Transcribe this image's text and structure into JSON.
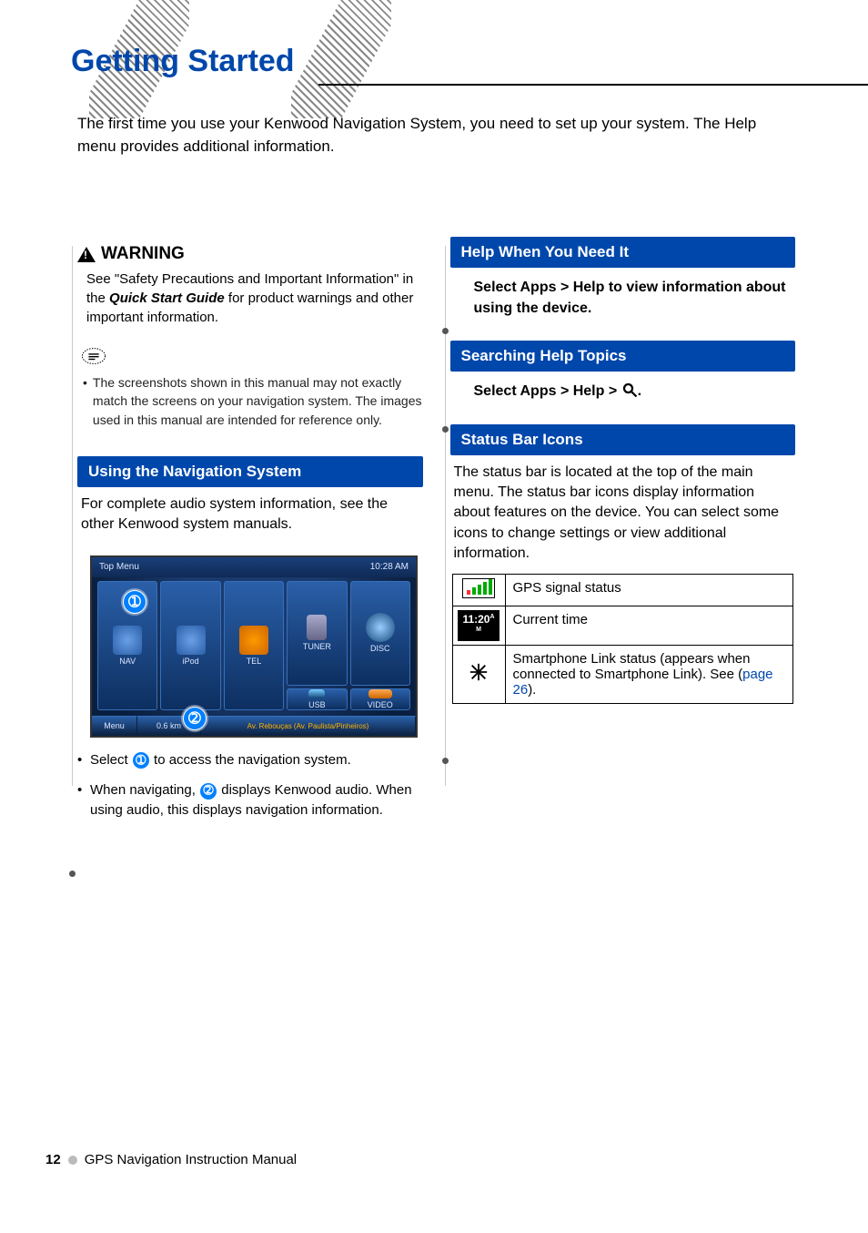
{
  "title": "Getting Started",
  "intro": "The first time you use your Kenwood Navigation System, you need to set up your system. The Help menu provides additional information.",
  "warning": {
    "label": "WARNING",
    "body_pre": "See \"Safety Precautions and Important Information\" in the ",
    "body_italic": "Quick Start Guide",
    "body_post": " for product warnings and other important information."
  },
  "note_bullet": "The screenshots shown in this manual may not exactly match the screens on your navigation system. The images used in this manual are intended for reference only.",
  "using_nav": {
    "bar": "Using the Navigation System",
    "text": "For complete audio system information, see the other Kenwood system manuals.",
    "bullets": {
      "b1_pre": "Select ",
      "b1_post": " to access the navigation system.",
      "b2_pre": "When navigating, ",
      "b2_post": " displays Kenwood audio. When using audio, this displays navigation information."
    }
  },
  "screenshot": {
    "top_label": "Top Menu",
    "clock": "10:28 AM",
    "tiles": [
      "NAV",
      "iPod",
      "TEL",
      "TUNER",
      "DISC",
      "USB",
      "VIDEO"
    ],
    "bottom_menu": "Menu",
    "bottom_dist": "0.6 km",
    "bottom_addr": "Av. Rebouças (Av. Paulista/Pinheiros)"
  },
  "help": {
    "bar": "Help When You Need It",
    "body": "Select Apps > Help to view information about using the device."
  },
  "searching": {
    "bar": "Searching Help Topics",
    "body_pre": "Select Apps > Help > ",
    "body_post": "."
  },
  "status": {
    "bar": "Status Bar Icons",
    "intro": "The status bar is located at the top of the main menu. The status bar icons display information about features on the device. You can select some icons to change settings or view additional information.",
    "rows": {
      "gps": "GPS signal status",
      "time_icon": "11:20",
      "time_text": "Current time",
      "link_pre": "Smartphone Link status (appears when connected to Smartphone Link). See (",
      "link_mid": "page 26",
      "link_post": ")."
    }
  },
  "footer": {
    "page": "12",
    "title": "GPS Navigation Instruction Manual"
  }
}
